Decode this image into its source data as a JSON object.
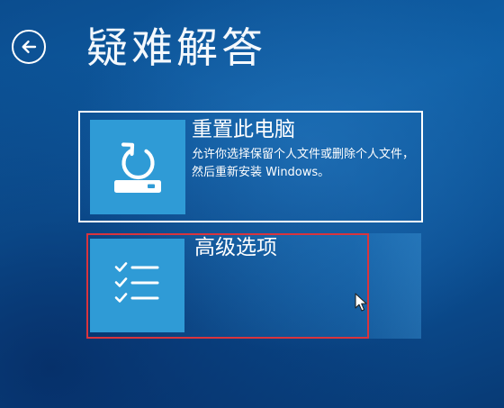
{
  "page": {
    "title": "疑难解答",
    "back_icon": "back-arrow-icon"
  },
  "options": [
    {
      "id": "reset-pc",
      "title": "重置此电脑",
      "description": "允许你选择保留个人文件或删除个人文件，然后重新安装 Windows。",
      "icon": "reset-icon",
      "outlined": true
    },
    {
      "id": "advanced-options",
      "title": "高级选项",
      "description": "",
      "icon": "checklist-icon",
      "highlighted": true
    }
  ],
  "colors": {
    "background": "#0f5fa6",
    "tile": "#2f9bd6",
    "highlight_border": "#d9343d",
    "text": "#ffffff"
  }
}
